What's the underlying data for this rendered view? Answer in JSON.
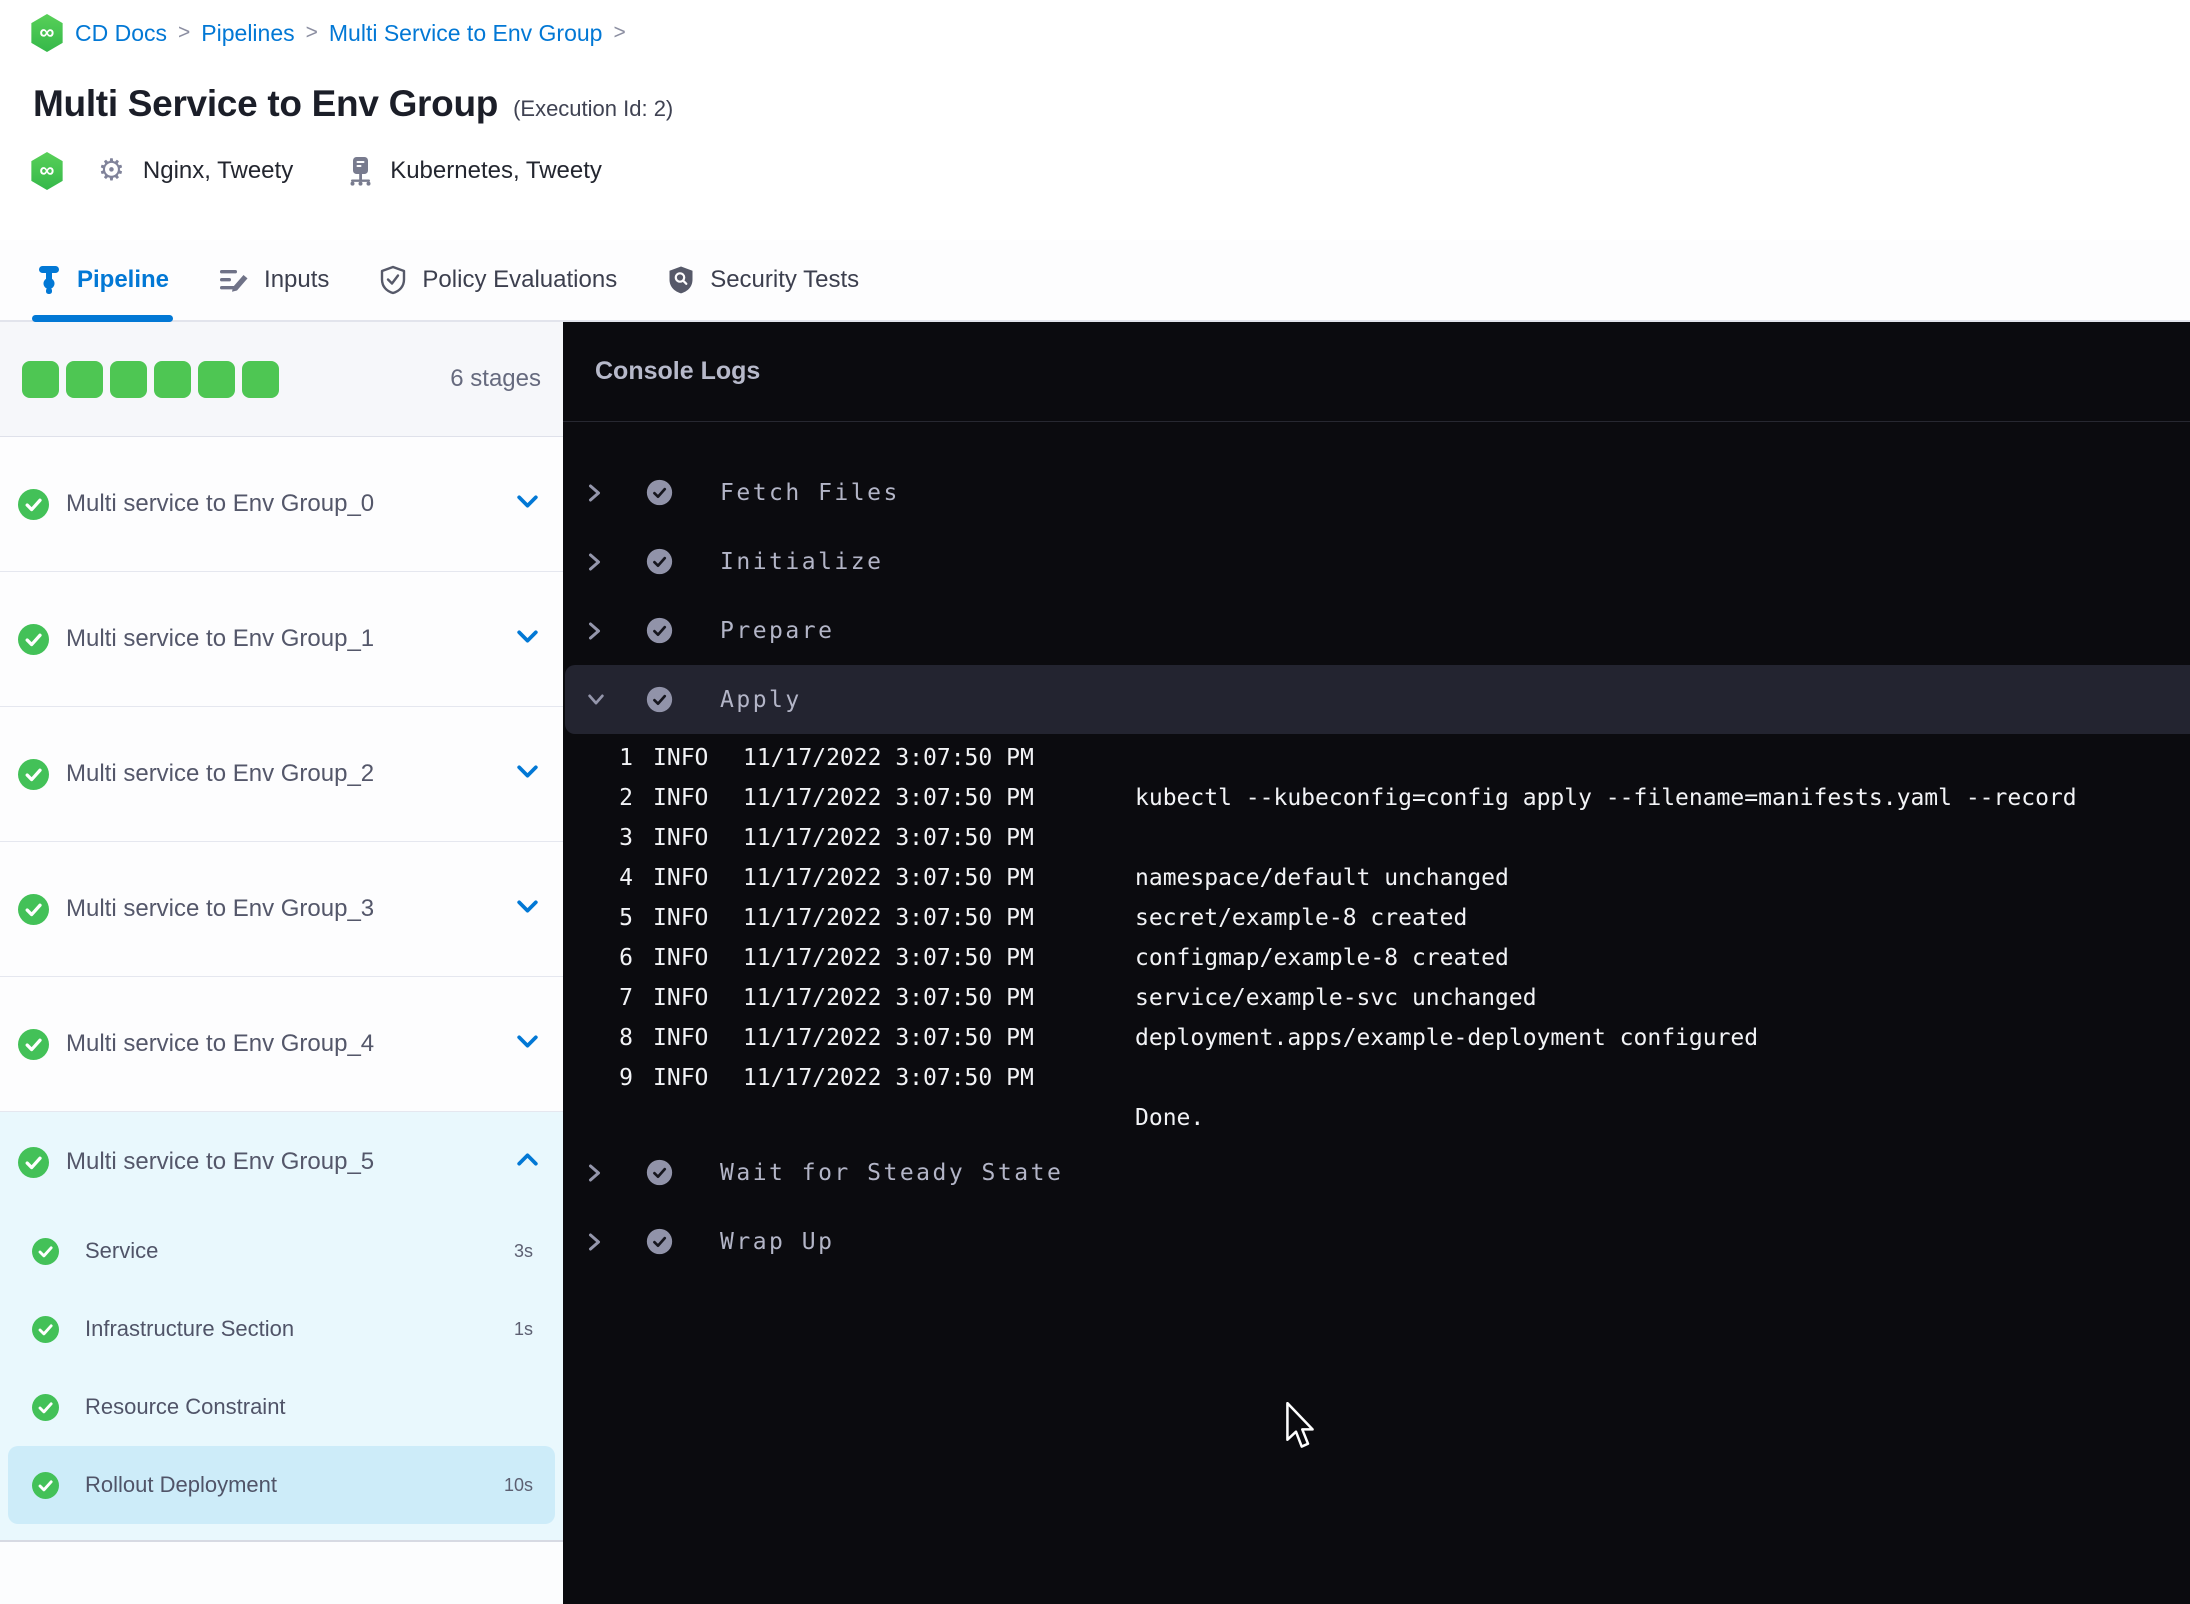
{
  "breadcrumb": {
    "items": [
      {
        "label": "CD Docs"
      },
      {
        "label": "Pipelines"
      },
      {
        "label": "Multi Service to Env Group"
      }
    ],
    "separator": ">"
  },
  "header": {
    "title": "Multi Service to Env Group",
    "execution_id_label": "(Execution Id: 2)",
    "services": "Nginx, Tweety",
    "environments": "Kubernetes, Tweety"
  },
  "tabs": [
    {
      "label": "Pipeline",
      "icon": "pipeline-icon",
      "active": true
    },
    {
      "label": "Inputs",
      "icon": "inputs-icon",
      "active": false
    },
    {
      "label": "Policy Evaluations",
      "icon": "shield-check-icon",
      "active": false
    },
    {
      "label": "Security Tests",
      "icon": "shield-search-icon",
      "active": false
    }
  ],
  "sidebar": {
    "progress_squares": 6,
    "stage_count_label": "6 stages",
    "stages": [
      {
        "name": "Multi service to Env Group_0",
        "status": "success",
        "expanded": false
      },
      {
        "name": "Multi service to Env Group_1",
        "status": "success",
        "expanded": false
      },
      {
        "name": "Multi service to Env Group_2",
        "status": "success",
        "expanded": false
      },
      {
        "name": "Multi service to Env Group_3",
        "status": "success",
        "expanded": false
      },
      {
        "name": "Multi service to Env Group_4",
        "status": "success",
        "expanded": false
      },
      {
        "name": "Multi service to Env Group_5",
        "status": "success",
        "expanded": true,
        "steps": [
          {
            "name": "Service",
            "duration": "3s",
            "status": "success",
            "selected": false
          },
          {
            "name": "Infrastructure Section",
            "duration": "1s",
            "status": "success",
            "selected": false
          },
          {
            "name": "Resource Constraint",
            "duration": "",
            "status": "success",
            "selected": false
          },
          {
            "name": "Rollout Deployment",
            "duration": "10s",
            "status": "success",
            "selected": true
          }
        ]
      }
    ]
  },
  "console": {
    "title": "Console Logs",
    "steps": [
      {
        "label": "Fetch Files",
        "status": "success",
        "expanded": false
      },
      {
        "label": "Initialize",
        "status": "success",
        "expanded": false
      },
      {
        "label": "Prepare",
        "status": "success",
        "expanded": false
      },
      {
        "label": "Apply",
        "status": "success",
        "expanded": true,
        "logs": [
          {
            "n": "1",
            "level": "INFO",
            "time": "11/17/2022 3:07:50 PM",
            "msg": ""
          },
          {
            "n": "2",
            "level": "INFO",
            "time": "11/17/2022 3:07:50 PM",
            "msg": "kubectl --kubeconfig=config apply --filename=manifests.yaml --record"
          },
          {
            "n": "3",
            "level": "INFO",
            "time": "11/17/2022 3:07:50 PM",
            "msg": ""
          },
          {
            "n": "4",
            "level": "INFO",
            "time": "11/17/2022 3:07:50 PM",
            "msg": "namespace/default unchanged"
          },
          {
            "n": "5",
            "level": "INFO",
            "time": "11/17/2022 3:07:50 PM",
            "msg": "secret/example-8 created"
          },
          {
            "n": "6",
            "level": "INFO",
            "time": "11/17/2022 3:07:50 PM",
            "msg": "configmap/example-8 created"
          },
          {
            "n": "7",
            "level": "INFO",
            "time": "11/17/2022 3:07:50 PM",
            "msg": "service/example-svc unchanged"
          },
          {
            "n": "8",
            "level": "INFO",
            "time": "11/17/2022 3:07:50 PM",
            "msg": "deployment.apps/example-deployment configured"
          },
          {
            "n": "9",
            "level": "INFO",
            "time": "11/17/2022 3:07:50 PM",
            "msg": ""
          },
          {
            "n": "",
            "level": "",
            "time": "",
            "msg": "Done."
          }
        ]
      },
      {
        "label": "Wait for Steady State",
        "status": "success",
        "expanded": false
      },
      {
        "label": "Wrap Up",
        "status": "success",
        "expanded": false
      }
    ]
  },
  "colors": {
    "accent": "#0278d5",
    "success": "#4ec653",
    "success_circle": "#43c158",
    "console_bg": "#0b0b0f",
    "console_row_highlight": "#232430",
    "console_text": "#f2f3f6",
    "console_muted": "#b3b5c7",
    "console_icon": "#9496ab",
    "selected_step_bg": "#cdecf9",
    "expanded_bg": "#e9f8fd",
    "sidebar_header_bg": "#f6f7fa",
    "divider": "#e5e7ef",
    "text_dark": "#1b1e28",
    "text_gray": "#54576a",
    "text_muted": "#666a7e"
  }
}
